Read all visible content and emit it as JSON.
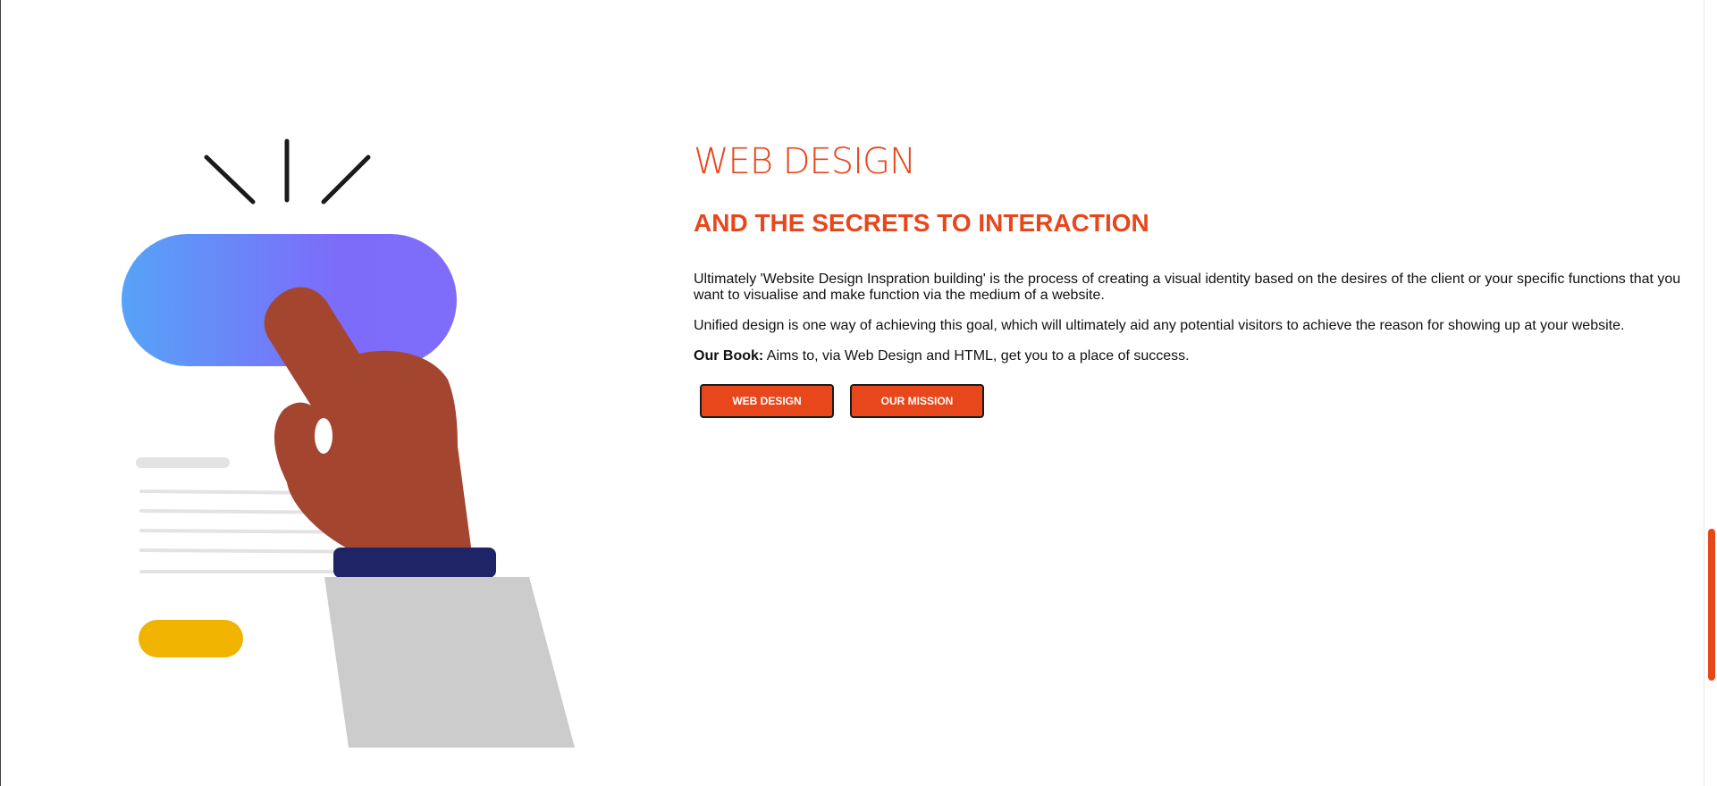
{
  "hero": {
    "title": "WEB DESIGN",
    "subtitle": "AND THE SECRETS TO INTERACTION",
    "paragraph1": "Ultimately 'Website Design Inspration building' is the process of creating a visual identity based on the desires of the client or your specific functions that you want to visualise and make function via the medium of a website.",
    "paragraph2": "Unified design is one way of achieving this goal, which will ultimately aid any potential visitors to achieve the reason for showing up at your website.",
    "paragraph3_label": "Our Book:",
    "paragraph3_text": " Aims to, via Web Design and HTML, get you to a place of success.",
    "buttons": {
      "web_design": "WEB DESIGN",
      "our_mission": "OUR MISSION"
    }
  },
  "illustration": {
    "icon": "hand-pressing-button-illustration"
  },
  "colors": {
    "accent": "#e8461b",
    "button_gradient_start": "#56a3f7",
    "button_gradient_end": "#7d6bfa",
    "hand": "#a44530",
    "cuff": "#1f2466",
    "sleeve": "#cccccc",
    "pill": "#f0b400",
    "lines": "#e3e3e3"
  }
}
